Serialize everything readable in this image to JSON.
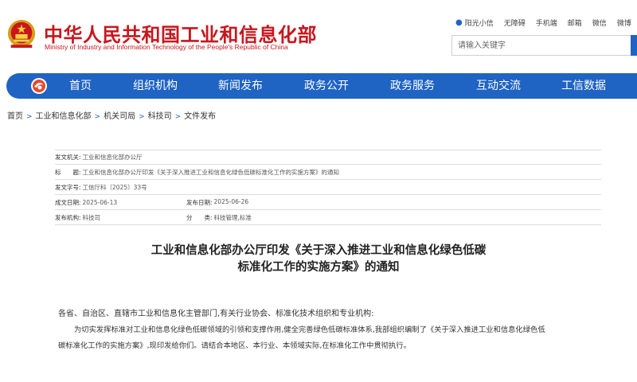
{
  "header": {
    "title": "中华人民共和国工业和信息化部",
    "subtitle": "Ministry of Industry and Information Technology of the People's Republic of China",
    "top_links": [
      "阳光小信",
      "无障碍",
      "手机端",
      "邮箱",
      "微信",
      "微博"
    ],
    "search_placeholder": "请输入关键字"
  },
  "nav": {
    "items": [
      "首页",
      "组织机构",
      "新闻发布",
      "政务公开",
      "政务服务",
      "互动交流",
      "工信数据"
    ]
  },
  "breadcrumb": [
    "首页",
    "工业和信息化部",
    "机关司局",
    "科技司",
    "文件发布"
  ],
  "meta": {
    "issuer_label": "发文机关:",
    "issuer": "工业和信息化部办公厅",
    "title_label": "标　　题:",
    "title": "工业和信息化部办公厅印发《关于深入推进工业和信息化绿色低碳标准化工作的实施方案》的通知",
    "docnum_label": "发文字号:",
    "docnum": "工信厅科〔2025〕33号",
    "created_label": "成文日期:",
    "created": "2025-06-13",
    "published_label": "发布日期:",
    "published": "2025-06-26",
    "org_label": "发布机构:",
    "org": "科技司",
    "category_label": "分　　类:",
    "category": "科技管理,标准"
  },
  "document": {
    "title_line1": "工业和信息化部办公厅印发《关于深入推进工业和信息化绿色低碳",
    "title_line2": "标准化工作的实施方案》的通知",
    "addressee": "各省、自治区、直辖市工业和信息化主管部门,有关行业协会、标准化技术组织和专业机构:",
    "para1_line1": "为切实发挥标准对工业和信息化绿色低碳领域的引领和支撑作用,健全完善绿色低碳标准体系,我部组织编制了《关于深入推进工业和信息化绿色低",
    "para1_line2": "碳标准化工作的实施方案》,现印发给你们。请结合本地区、本行业、本领域实际,在标准化工作中贯彻执行。"
  },
  "colors": {
    "brand_red": "#c8161d",
    "nav_blue": "#1f63c3"
  }
}
